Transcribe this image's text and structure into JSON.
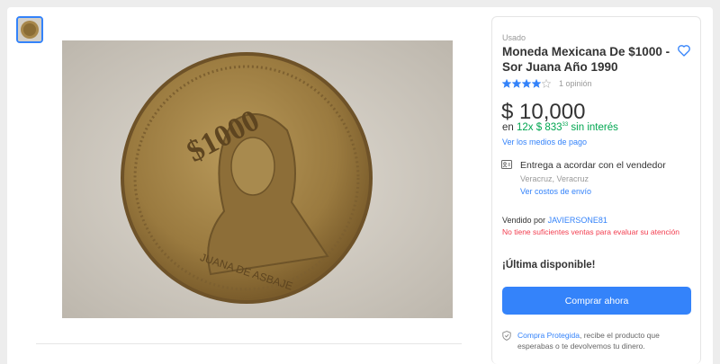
{
  "product": {
    "condition": "Usado",
    "title": "Moneda Mexicana De $1000 - Sor Juana Año 1990",
    "rating_stars": 4,
    "reviews_label": "1 opinión"
  },
  "pricing": {
    "price": "$ 10,000",
    "installments_prefix": "en",
    "installments_count": "12x",
    "installment_amount": "$ 833",
    "installment_cents": "33",
    "installments_suffix": "sin interés",
    "payment_methods_link": "Ver los medios de pago"
  },
  "shipping": {
    "title": "Entrega a acordar con el vendedor",
    "location": "Veracruz, Veracruz",
    "costs_link": "Ver costos de envío"
  },
  "seller": {
    "prefix": "Vendido por",
    "name": "JAVIERSONE81",
    "warning": "No tiene suficientes ventas para evaluar su atención"
  },
  "stock": {
    "label": "¡Última disponible!"
  },
  "actions": {
    "buy_now": "Comprar ahora"
  },
  "protection": {
    "link": "Compra Protegida",
    "text": ", recibe el producto que esperabas o te devolvemos tu dinero."
  },
  "coin": {
    "denomination": "$1000",
    "legend": "JUANA DE ASBAJE"
  },
  "colors": {
    "accent": "#3483fa",
    "green": "#00a650",
    "red": "#f23d4f"
  }
}
